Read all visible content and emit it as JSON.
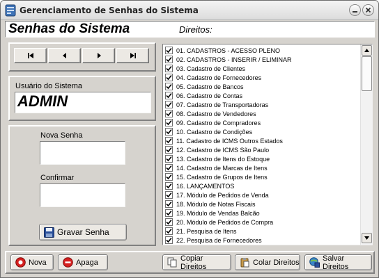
{
  "window": {
    "title": "Gerenciamento de Senhas do Sistema"
  },
  "header": {
    "title": "Senhas do Sistema",
    "rights_label": "Direitos:"
  },
  "navigation": {
    "buttons": [
      {
        "name": "first-record-button",
        "icon": "skip-first-icon"
      },
      {
        "name": "previous-record-button",
        "icon": "prev-icon"
      },
      {
        "name": "next-record-button",
        "icon": "next-icon"
      },
      {
        "name": "last-record-button",
        "icon": "skip-last-icon"
      }
    ]
  },
  "user": {
    "label": "Usuário do Sistema",
    "value": "ADMIN"
  },
  "password": {
    "new_label": "Nova Senha",
    "new_value": "",
    "confirm_label": "Confirmar",
    "confirm_value": "",
    "save_button": "Gravar Senha"
  },
  "rights": {
    "items": [
      {
        "label": "01. CADASTROS - ACESSO PLENO",
        "checked": true
      },
      {
        "label": "02. CADASTROS - INSERIR / ELIMINAR",
        "checked": true
      },
      {
        "label": "03. Cadastro de Clientes",
        "checked": true
      },
      {
        "label": "04. Cadastro de Fornecedores",
        "checked": true
      },
      {
        "label": "05. Cadastro de Bancos",
        "checked": true
      },
      {
        "label": "06. Cadastro de Contas",
        "checked": true
      },
      {
        "label": "07. Cadastro de Transportadoras",
        "checked": true
      },
      {
        "label": "08. Cadastro de Vendedores",
        "checked": true
      },
      {
        "label": "09. Cadastro de Compradores",
        "checked": true
      },
      {
        "label": "10. Cadastro de Condições",
        "checked": true
      },
      {
        "label": "11. Cadastro de ICMS Outros Estados",
        "checked": true
      },
      {
        "label": "12. Cadastro de ICMS São Paulo",
        "checked": true
      },
      {
        "label": "13. Cadastro de Itens do Estoque",
        "checked": true
      },
      {
        "label": "14. Cadastro de Marcas de Itens",
        "checked": true
      },
      {
        "label": "15. Cadastro de Grupos de Itens",
        "checked": true
      },
      {
        "label": "16. LANÇAMENTOS",
        "checked": true
      },
      {
        "label": "17. Módulo de Pedidos de Venda",
        "checked": true
      },
      {
        "label": "18. Módulo de Notas Fiscais",
        "checked": true
      },
      {
        "label": "19. Módulo de Vendas Balcão",
        "checked": true
      },
      {
        "label": "20. Módulo de Pedidos de Compra",
        "checked": true
      },
      {
        "label": "21. Pesquisa de Itens",
        "checked": true
      },
      {
        "label": "22. Pesquisa de Fornecedores",
        "checked": true
      }
    ]
  },
  "actions": {
    "new": "Nova",
    "delete": "Apaga",
    "copy": "Copiar Direitos",
    "paste": "Colar Direitos",
    "save": "Salvar Direitos"
  },
  "colors": {
    "header_bg": "#ffffff",
    "window_bg": "#d6d3ce",
    "icon_red": "#d62020",
    "icon_blue": "#2a4f9a"
  }
}
